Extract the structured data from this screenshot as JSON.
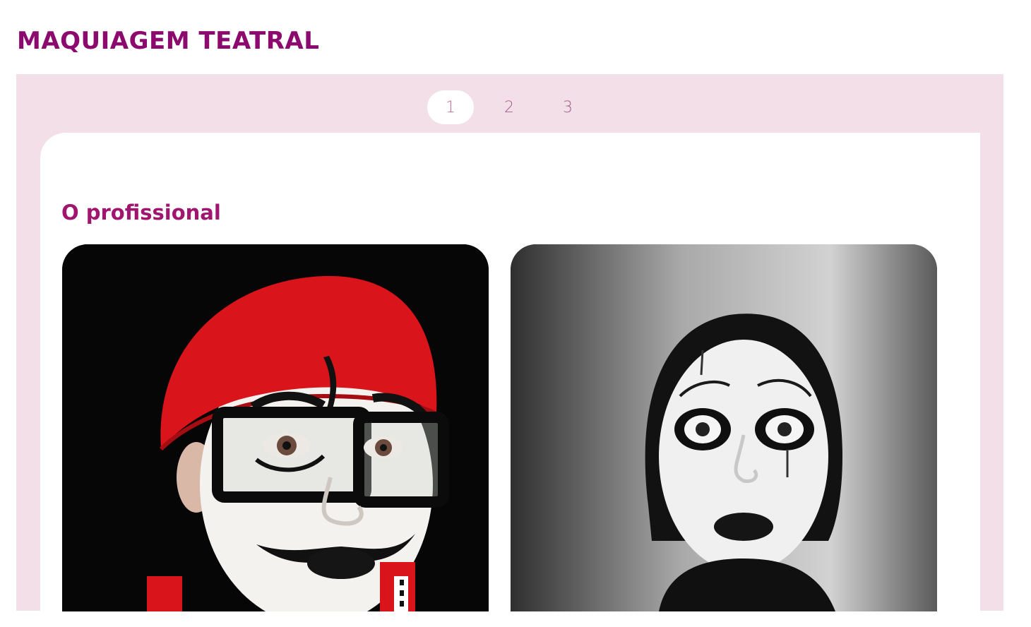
{
  "page": {
    "title": "MAQUIAGEM TEATRAL"
  },
  "pagination": {
    "pages": [
      "1",
      "2",
      "3"
    ],
    "active": "1"
  },
  "section": {
    "title": "O profissional"
  },
  "photos": [
    {
      "icon": "mime-red-beret-photo"
    },
    {
      "icon": "mime-black-white-photo"
    }
  ],
  "colors": {
    "title": "#8c0a6e",
    "section_title": "#a0156f",
    "panel_bg": "#f2dfe8",
    "pager_text": "#a15e88"
  }
}
